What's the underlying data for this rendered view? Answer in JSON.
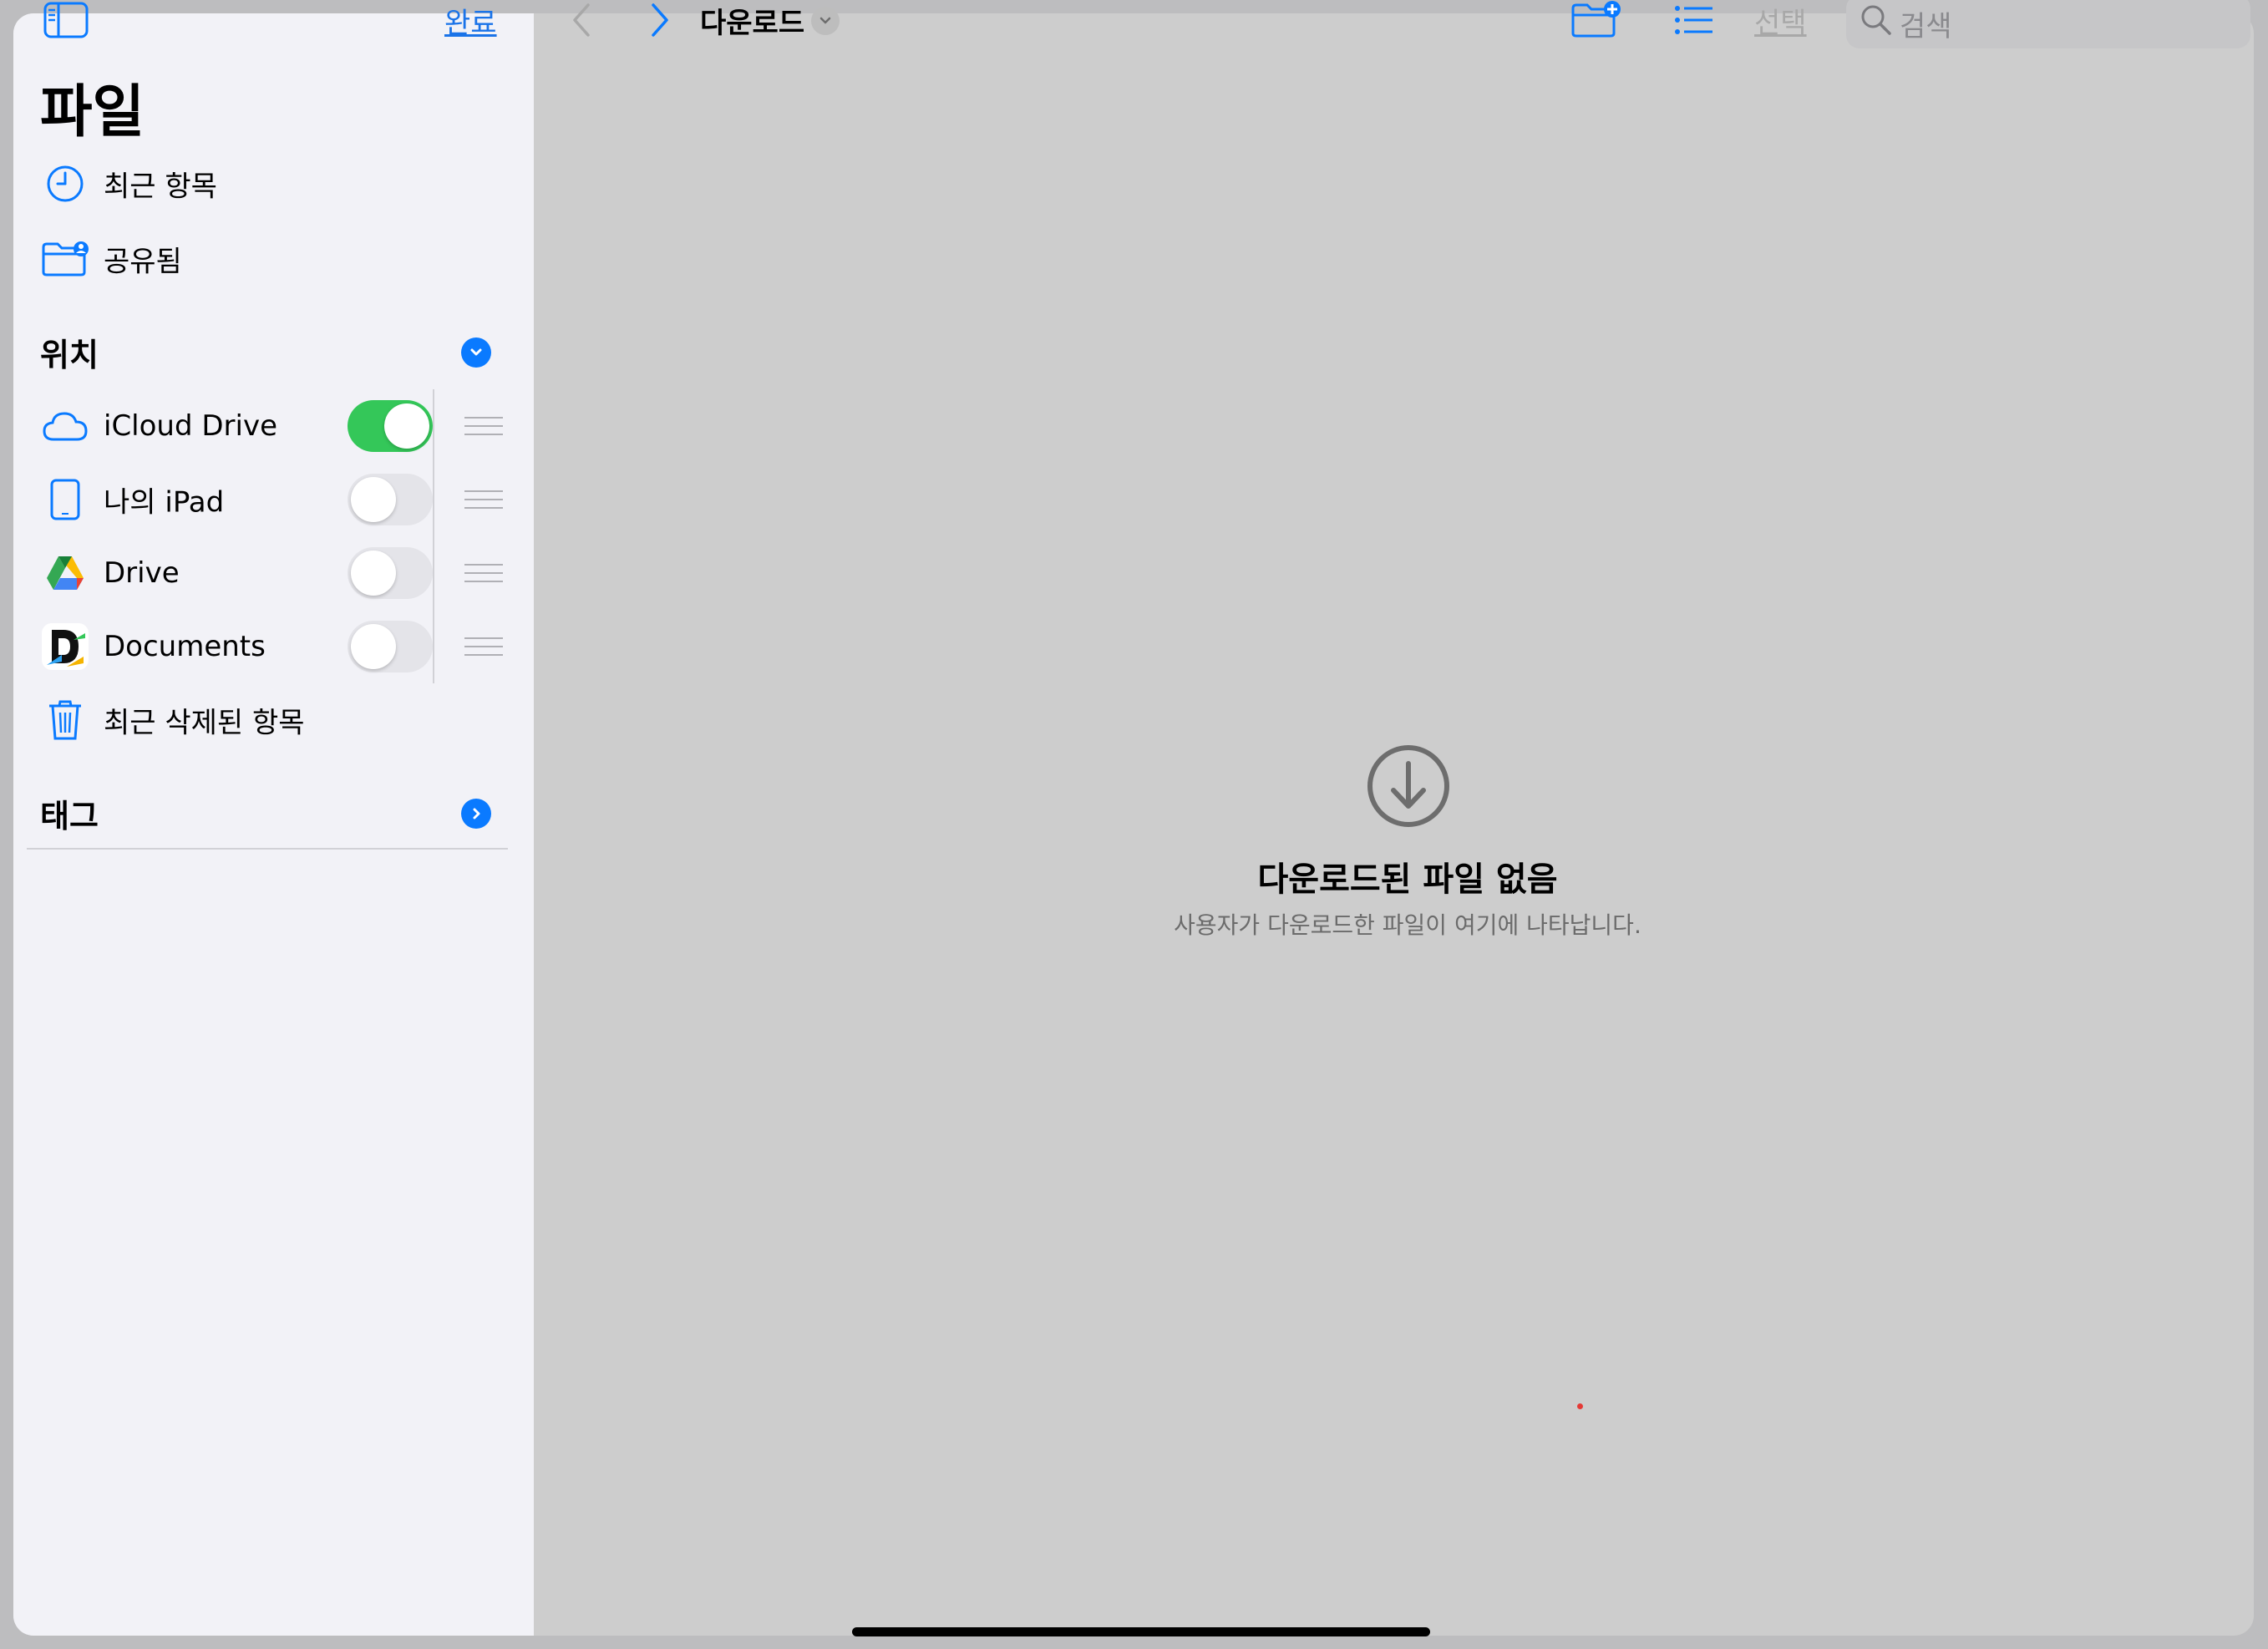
{
  "sidebar": {
    "done_label": "완료",
    "title": "파일",
    "favorites": [
      {
        "label": "최근 항목",
        "icon": "clock-icon"
      },
      {
        "label": "공유됨",
        "icon": "shared-folder-icon"
      }
    ],
    "locations_header": "위치",
    "locations": [
      {
        "label": "iCloud Drive",
        "icon": "icloud-icon",
        "enabled": true
      },
      {
        "label": "나의 iPad",
        "icon": "ipad-icon",
        "enabled": false
      },
      {
        "label": "Drive",
        "icon": "google-drive-icon",
        "enabled": false
      },
      {
        "label": "Documents",
        "icon": "documents-app-icon",
        "enabled": false
      }
    ],
    "recently_deleted": {
      "label": "최근 삭제된 항목",
      "icon": "trash-icon"
    },
    "tags_header": "태그"
  },
  "toolbar": {
    "title": "다운로드",
    "select_label": "선택",
    "search_placeholder": "검색"
  },
  "empty_state": {
    "title": "다운로드된 파일 없음",
    "subtitle": "사용자가 다운로드한 파일이 여기에 나타납니다.",
    "icon": "download-circle-icon"
  },
  "colors": {
    "accent": "#0a7aff",
    "toggle_on": "#34c759",
    "sidebar_bg": "#f2f2f7",
    "main_bg": "#cdcdcd"
  }
}
